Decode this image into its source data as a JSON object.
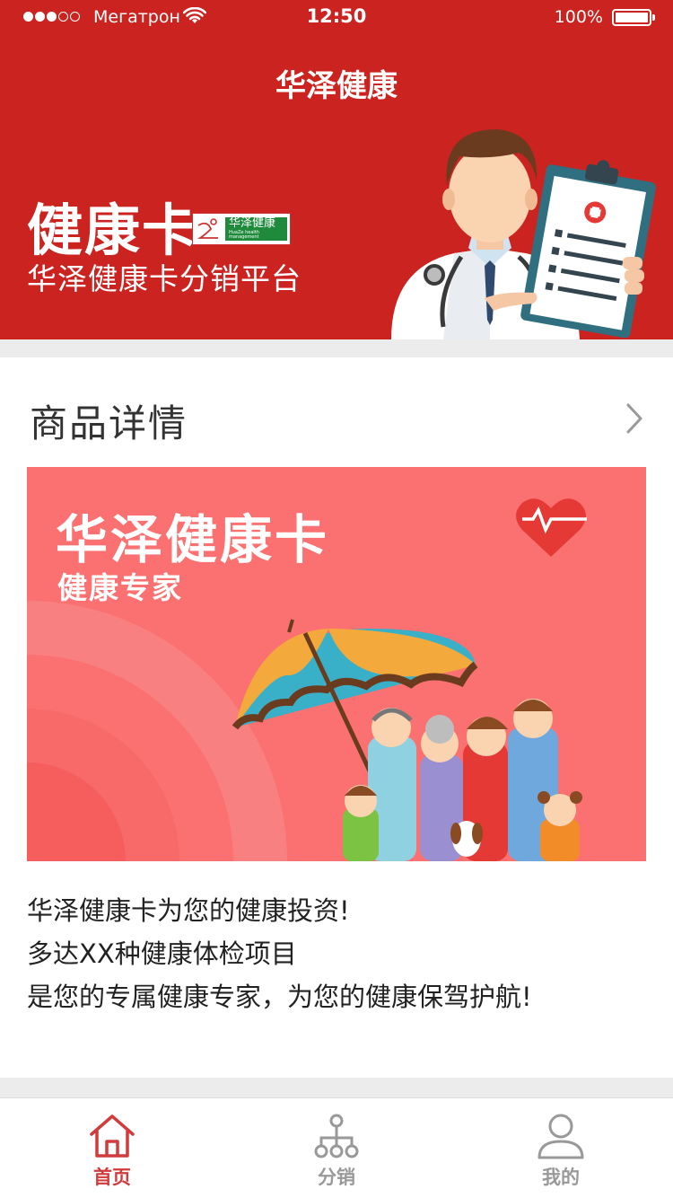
{
  "status_bar": {
    "carrier": "Мегатрон",
    "time": "12:50",
    "battery": "100%",
    "signal_bars_filled": 3,
    "signal_bars_total": 5
  },
  "header": {
    "title": "华泽健康",
    "banner_title": "健康卡",
    "banner_subtitle": "华泽健康卡分销平台",
    "logo_text": "华泽健康",
    "logo_small": "HuaZe health management"
  },
  "product": {
    "section_title": "商品详情",
    "image_title": "华泽健康卡",
    "image_subtitle": "健康专家",
    "description": [
      "华泽健康卡为您的健康投资!",
      "多达XX种健康体检项目",
      "是您的专属健康专家，为您的健康保驾护航!"
    ]
  },
  "tabbar": {
    "tabs": [
      {
        "label": "首页",
        "icon": "home-icon",
        "active": true
      },
      {
        "label": "分销",
        "icon": "distribution-icon",
        "active": false
      },
      {
        "label": "我的",
        "icon": "profile-icon",
        "active": false
      }
    ]
  },
  "colors": {
    "brand_red": "#cb2420",
    "image_bg": "#fb7171",
    "active_tab": "#d13b3b",
    "inactive_tab": "#999999",
    "logo_green": "#1f8a3b"
  }
}
